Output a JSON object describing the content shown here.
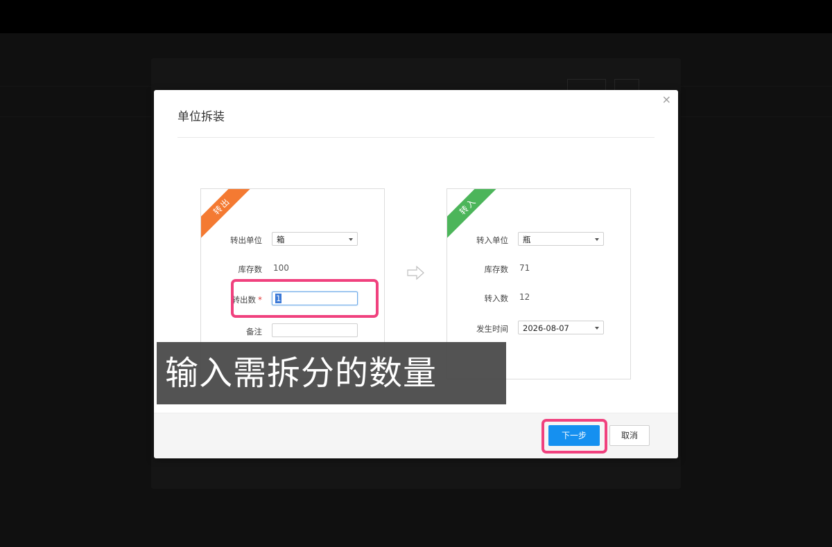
{
  "modal": {
    "title": "单位拆装",
    "close_glyph": "×",
    "out_panel": {
      "ribbon": "转出",
      "unit_label": "转出单位",
      "unit_value": "箱",
      "stock_label": "库存数",
      "stock_value": "100",
      "qty_label": "转出数",
      "required_mark": "*",
      "qty_value": "1",
      "remark_label": "备注",
      "remark_value": ""
    },
    "in_panel": {
      "ribbon": "转入",
      "unit_label": "转入单位",
      "unit_value": "瓶",
      "stock_label": "库存数",
      "stock_value": "71",
      "qty_label": "转入数",
      "qty_value": "12",
      "date_label": "发生时间",
      "date_value": "2026-08-07"
    },
    "buttons": {
      "next": "下一步",
      "cancel": "取消"
    }
  },
  "caption": "输入需拆分的数量",
  "colors": {
    "out_ribbon": "#f47a32",
    "in_ribbon": "#4cb55a",
    "primary": "#1590f0",
    "highlight": "#f0417e"
  }
}
